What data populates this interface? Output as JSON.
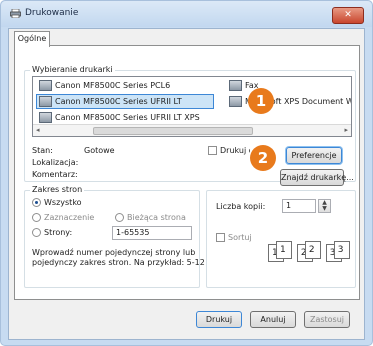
{
  "window": {
    "title": "Drukowanie",
    "close_symbol": "✕"
  },
  "tab": {
    "label": "Ogólne"
  },
  "select_printer": {
    "label": "Wybieranie drukarki",
    "printers": [
      {
        "name": "Canon MF8500C Series PCL6"
      },
      {
        "name": "Canon MF8500C Series UFRII LT"
      },
      {
        "name": "Canon MF8500C Series UFRII LT XPS"
      },
      {
        "name": "Fax"
      },
      {
        "name": "Microsoft XPS Document Writer"
      }
    ],
    "selected_index": 1,
    "print_to_file": "Drukuj do pliku",
    "preferences": "Preferencje",
    "find_printer": "Znajdź drukarkę..."
  },
  "status": {
    "label": "Stan:",
    "value": "Gotowe",
    "location_label": "Lokalizacja:",
    "comment_label": "Komentarz:"
  },
  "page_range": {
    "label": "Zakres stron",
    "all": "Wszystko",
    "selection": "Zaznaczenie",
    "current": "Bieżąca strona",
    "pages": "Strony:",
    "pages_value": "1-65535",
    "hint_line1": "Wprowadź numer pojedynczej strony lub",
    "hint_line2": "pojedynczy zakres stron. Na przykład: 5-12"
  },
  "copies": {
    "label": "Liczba kopii:",
    "value": "1",
    "collate": "Sortuj",
    "collate_pages": [
      "1",
      "1",
      "2",
      "2",
      "3",
      "3"
    ]
  },
  "buttons": {
    "print": "Drukuj",
    "cancel": "Anuluj",
    "apply": "Zastosuj"
  },
  "callouts": [
    "1",
    "2"
  ]
}
